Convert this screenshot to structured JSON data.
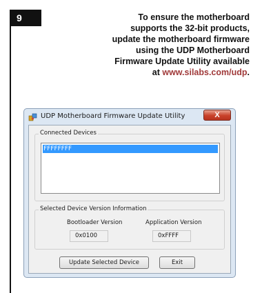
{
  "step": {
    "number": "9"
  },
  "instructions": {
    "line1": "To ensure the motherboard",
    "line2": "supports the 32-bit products,",
    "line3": "update the motherboard firmware",
    "line4": "using the UDP Motherboard",
    "line5": "Firmware Update Utility available",
    "line6_prefix": "at ",
    "link": "www.silabs.com/udp",
    "line6_suffix": "."
  },
  "window": {
    "title": "UDP Motherboard Firmware Update Utility",
    "close_label": "X",
    "connected_devices": {
      "label": "Connected Devices",
      "items": [
        "FFFFFFFF"
      ]
    },
    "version_info": {
      "label": "Selected Device Version Information",
      "bootloader_label": "Bootloader Version",
      "bootloader_value": "0x0100",
      "application_label": "Application Version",
      "application_value": "0xFFFF"
    },
    "update_button": "Update Selected Device",
    "exit_button": "Exit"
  },
  "colors": {
    "selection": "#3399ff",
    "link": "#a03a3a",
    "badge": "#111111"
  },
  "icons": {
    "app": "motherboard-puzzle-icon"
  }
}
